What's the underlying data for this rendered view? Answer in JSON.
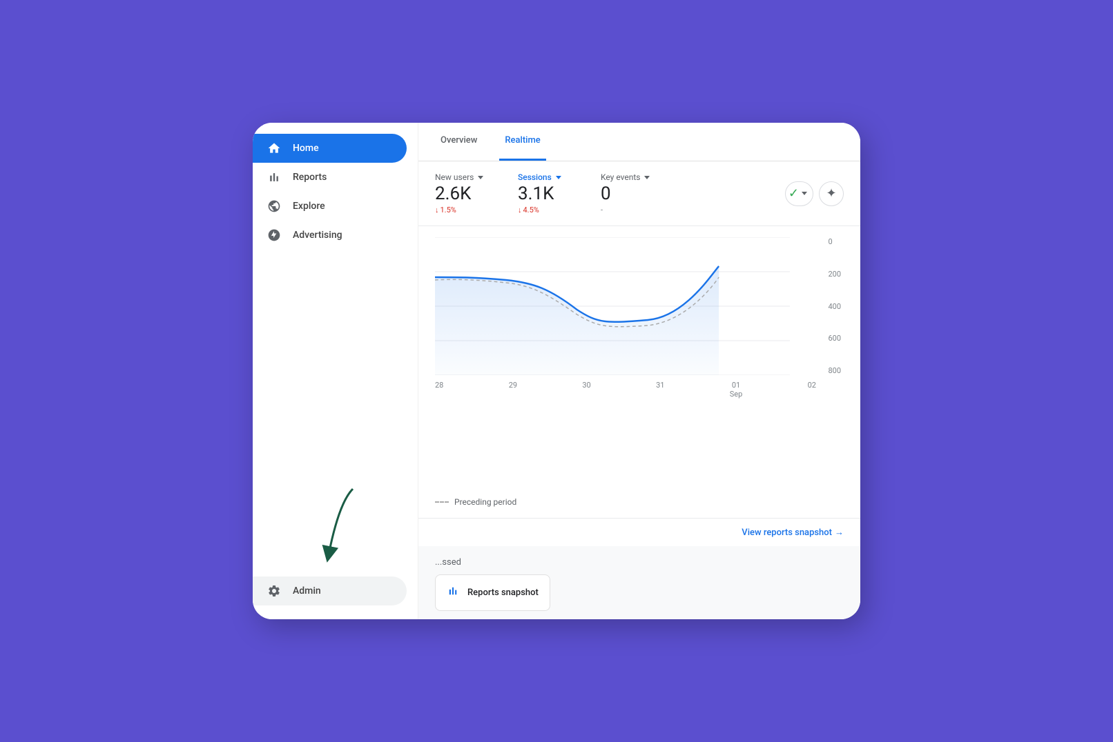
{
  "app": {
    "background_color": "#5b4fcf"
  },
  "sidebar": {
    "nav_items": [
      {
        "id": "home",
        "label": "Home",
        "icon": "home",
        "active": true
      },
      {
        "id": "reports",
        "label": "Reports",
        "icon": "bar-chart",
        "active": false
      },
      {
        "id": "explore",
        "label": "Explore",
        "icon": "explore",
        "active": false
      },
      {
        "id": "advertising",
        "label": "Advertising",
        "icon": "advertising",
        "active": false
      }
    ],
    "bottom_items": [
      {
        "id": "admin",
        "label": "Admin",
        "icon": "gear"
      }
    ]
  },
  "tabs": [
    {
      "id": "overview",
      "label": "Overview",
      "active": false
    },
    {
      "id": "realtime",
      "label": "Realtime",
      "active": true
    }
  ],
  "metrics": [
    {
      "id": "new-users",
      "label": "New users",
      "value": "2.6K",
      "change": "↓ 1.5%",
      "change_type": "down",
      "has_dropdown": true
    },
    {
      "id": "sessions",
      "label": "Sessions",
      "value": "3.1K",
      "change": "↓ 4.5%",
      "change_type": "down",
      "has_dropdown": true,
      "active": true
    },
    {
      "id": "key-events",
      "label": "Key events",
      "value": "0",
      "change": "-",
      "change_type": "neutral",
      "has_dropdown": true
    }
  ],
  "chart": {
    "y_axis_labels": [
      "0",
      "200",
      "400",
      "600",
      "800"
    ],
    "x_axis_labels": [
      "28",
      "29",
      "30",
      "31",
      "01\nSep",
      "02"
    ],
    "legend": {
      "preceding_period": "Preceding period"
    }
  },
  "view_reports": {
    "label": "View reports snapshot",
    "arrow": "→"
  },
  "recently_accessed": {
    "title": "...ssed",
    "cards": [
      {
        "id": "reports-snapshot",
        "label": "Reports snapshot",
        "icon": "bar-chart"
      }
    ]
  },
  "action_buttons": {
    "verified_label": "",
    "sparkle_label": "✦"
  }
}
